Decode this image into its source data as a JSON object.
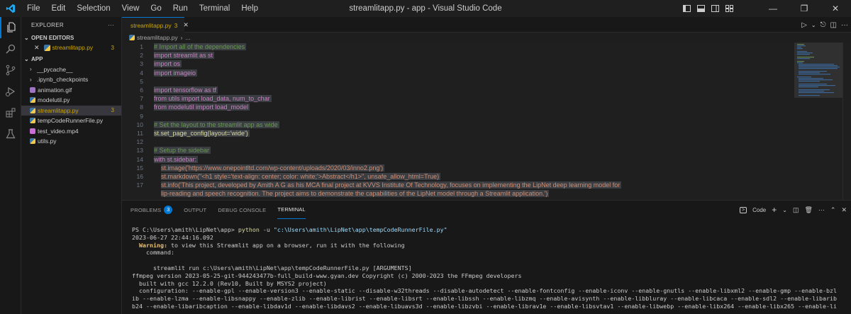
{
  "window": {
    "title": "streamlitapp.py - app - Visual Studio Code"
  },
  "menu": [
    "File",
    "Edit",
    "Selection",
    "View",
    "Go",
    "Run",
    "Terminal",
    "Help"
  ],
  "sidebar": {
    "header": "EXPLORER",
    "open_editors": {
      "label": "OPEN EDITORS",
      "items": [
        {
          "name": "streamlitapp.py",
          "problems": "3"
        }
      ]
    },
    "folder": {
      "label": "APP"
    },
    "items": [
      {
        "name": "__pycache__",
        "kind": "folder"
      },
      {
        "name": ".ipynb_checkpoints",
        "kind": "folder"
      },
      {
        "name": "animation.gif",
        "kind": "gif"
      },
      {
        "name": "modelutil.py",
        "kind": "py"
      },
      {
        "name": "streamlitapp.py",
        "kind": "py",
        "problems": "3"
      },
      {
        "name": "tempCodeRunnerFile.py",
        "kind": "py"
      },
      {
        "name": "test_video.mp4",
        "kind": "mp4"
      },
      {
        "name": "utils.py",
        "kind": "py"
      }
    ]
  },
  "editor": {
    "tab": {
      "label": "streamlitapp.py",
      "problems": "3"
    },
    "breadcrumb": {
      "file": "streamlitapp.py",
      "rest": "..."
    },
    "code": [
      {
        "n": "1",
        "t": "# Import all of the dependencies"
      },
      {
        "n": "2",
        "t": "import streamlit as st"
      },
      {
        "n": "3",
        "t": "import os"
      },
      {
        "n": "4",
        "t": "import imageio"
      },
      {
        "n": "5",
        "t": ""
      },
      {
        "n": "6",
        "t": "import tensorflow as tf"
      },
      {
        "n": "7",
        "t": "from utils import load_data, num_to_char"
      },
      {
        "n": "8",
        "t": "from modelutil import load_model"
      },
      {
        "n": "9",
        "t": ""
      },
      {
        "n": "10",
        "t": "# Set the layout to the streamlit app as wide"
      },
      {
        "n": "11",
        "t": "st.set_page_config(layout='wide')"
      },
      {
        "n": "12",
        "t": ""
      },
      {
        "n": "13",
        "t": "# Setup the sidebar"
      },
      {
        "n": "14",
        "t": "with st.sidebar:"
      },
      {
        "n": "15",
        "t": "st.image('https://www.onepointltd.com/wp-content/uploads/2020/03/inno2.png')"
      },
      {
        "n": "16",
        "t": "st.markdown(\"<h1 style='text-align: center; color: white;'>Abstract</h1>\", unsafe_allow_html=True)"
      },
      {
        "n": "17",
        "t": "st.info('This project, developed by Amith A G as his MCA final project at KVVS Institute Of Technology, focuses on implementing the LipNet deep learning model for"
      },
      {
        "n": "",
        "t": "lip-reading and speech recognition. The project aims to demonstrate the capabilities of the LipNet model through a Streamlit application.')"
      }
    ]
  },
  "panel": {
    "tabs": {
      "problems": "PROBLEMS",
      "problems_count": "3",
      "output": "OUTPUT",
      "debug": "DEBUG CONSOLE",
      "terminal": "TERMINAL"
    },
    "shell": "Code",
    "terminal": {
      "prompt": "PS C:\\Users\\amith\\LipNet\\app> ",
      "cmd": "python",
      "args": " -u ",
      "path": "\"c:\\Users\\amith\\LipNet\\app\\tempCodeRunnerFile.py\"",
      "lines": [
        "2023-06-27 22:44:16.092",
        "",
        "    command:",
        "",
        "      streamlit run c:\\Users\\amith\\LipNet\\app\\tempCodeRunnerFile.py [ARGUMENTS]",
        "ffmpeg version 2023-05-25-git-944243477b-full_build-www.gyan.dev Copyright (c) 2000-2023 the FFmpeg developers",
        "  built with gcc 12.2.0 (Rev10, Built by MSYS2 project)",
        "  configuration: --enable-gpl --enable-version3 --enable-static --disable-w32threads --disable-autodetect --enable-fontconfig --enable-iconv --enable-gnutls --enable-libxml2 --enable-gmp --enable-bzl",
        "ib --enable-lzma --enable-libsnappy --enable-zlib --enable-librist --enable-libsrt --enable-libssh --enable-libzmq --enable-avisynth --enable-libbluray --enable-libcaca --enable-sdl2 --enable-libarib",
        "b24 --enable-libaribcaption --enable-libdav1d --enable-libdavs2 --enable-libuavs3d --enable-libzvbi --enable-librav1e --enable-libsvtav1 --enable-libwebp --enable-libx264 --enable-libx265 --enable-li"
      ],
      "warn_label": "Warning:",
      "warn_text": " to view this Streamlit app on a browser, run it with the following"
    }
  },
  "colors": {
    "accent": "#0078d4",
    "warning": "#cca700"
  }
}
